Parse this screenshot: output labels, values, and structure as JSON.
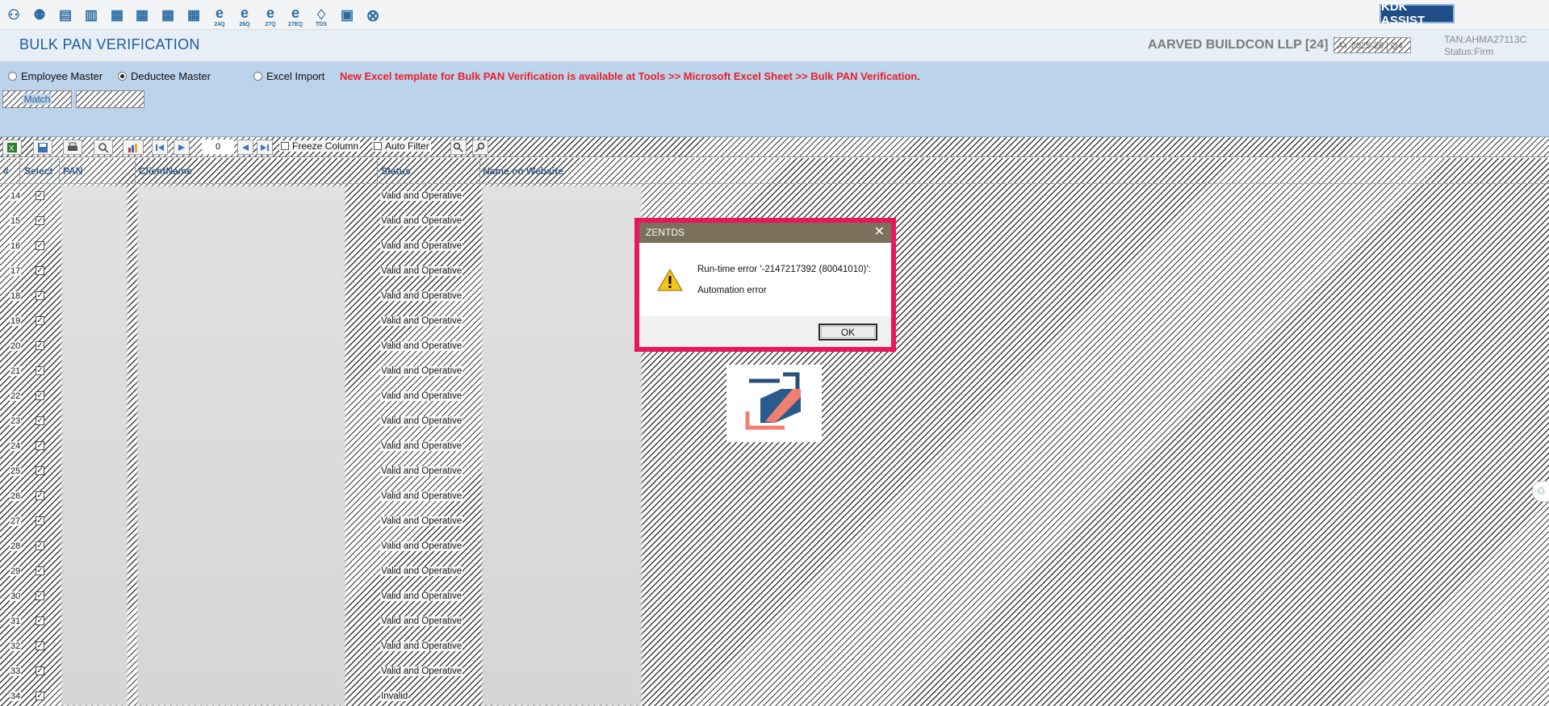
{
  "toolbar": {
    "icons": [
      {
        "name": "people-icon",
        "label": ""
      },
      {
        "name": "group-icon",
        "label": ""
      },
      {
        "name": "form-icon",
        "label": ""
      },
      {
        "name": "form-alt-icon",
        "label": ""
      },
      {
        "name": "form-24q-icon",
        "label": ""
      },
      {
        "name": "form-26q-icon",
        "label": ""
      },
      {
        "name": "form-27q-icon",
        "label": ""
      },
      {
        "name": "form-27eq-icon",
        "label": ""
      },
      {
        "name": "e-24q-icon",
        "label": "24Q"
      },
      {
        "name": "e-26q-icon",
        "label": "26Q"
      },
      {
        "name": "e-27q-icon",
        "label": "27Q"
      },
      {
        "name": "e-27eq-icon",
        "label": "27EQ"
      },
      {
        "name": "tds-icon",
        "label": "TDS"
      },
      {
        "name": "notepad-icon",
        "label": ""
      },
      {
        "name": "close-circle-icon",
        "label": ""
      }
    ],
    "assist_label": "KDK ASSIST"
  },
  "header": {
    "title": "BULK PAN VERIFICATION",
    "company": "AARVED BUILDCON LLP [24]",
    "ay": "AY 2025-26 | Q4",
    "tan": "TAN:AHMA27113C",
    "status": "Status:Firm"
  },
  "options": {
    "employee_master": "Employee Master",
    "deductee_master": "Deductee Master",
    "excel_import": "Excel Import",
    "selected": "deductee_master",
    "notice": "New Excel template for Bulk PAN Verification is available at Tools >> Microsoft Excel Sheet >> Bulk PAN Verification.",
    "match_label": "Match",
    "second_button_label": ""
  },
  "grid_tools": {
    "record_number": "0",
    "freeze_column": "Freeze Column",
    "auto_filter": "Auto Filter"
  },
  "grid": {
    "columns": [
      "#",
      "Select",
      "PAN",
      "ClientName",
      "Status",
      "Name on Website"
    ],
    "rows": [
      {
        "num": "14",
        "status": "Valid and Operative",
        "checked": true
      },
      {
        "num": "15",
        "status": "Valid and Operative",
        "checked": true
      },
      {
        "num": "16",
        "status": "Valid and Operative",
        "checked": true
      },
      {
        "num": "17",
        "status": "Valid and Operative",
        "checked": true
      },
      {
        "num": "18",
        "status": "Valid and Operative",
        "checked": true
      },
      {
        "num": "19",
        "status": "Valid and Operative",
        "checked": true
      },
      {
        "num": "20",
        "status": "Valid and Operative",
        "checked": true
      },
      {
        "num": "21",
        "status": "Valid and Operative",
        "checked": true
      },
      {
        "num": "22",
        "status": "Valid and Operative",
        "checked": true
      },
      {
        "num": "23",
        "status": "Valid and Operative",
        "checked": true
      },
      {
        "num": "24",
        "status": "Valid and Operative",
        "checked": true
      },
      {
        "num": "25",
        "status": "Valid and Operative",
        "checked": true
      },
      {
        "num": "26",
        "status": "Valid and Operative",
        "checked": true
      },
      {
        "num": "27",
        "status": "Valid and Operative",
        "checked": true
      },
      {
        "num": "28",
        "status": "Valid and Operative",
        "checked": true
      },
      {
        "num": "29",
        "status": "Valid and Operative",
        "checked": true
      },
      {
        "num": "30",
        "status": "Valid and Operative",
        "checked": true
      },
      {
        "num": "31",
        "status": "Valid and Operative",
        "checked": true
      },
      {
        "num": "32",
        "status": "Valid and Operative",
        "checked": true
      },
      {
        "num": "33",
        "status": "Valid and Operative",
        "checked": true
      },
      {
        "num": "34",
        "status": "Invalid",
        "checked": true
      }
    ]
  },
  "dialog": {
    "title": "ZENTDS",
    "close": "✕",
    "line1": "Run-time error '-2147217392 (80041010)':",
    "line2": "Automation error",
    "ok_label": "OK"
  },
  "colors": {
    "accent": "#1a5d9c",
    "highlight_border": "#e8175d",
    "notice": "#e8202a",
    "panel": "#bcd3ec"
  }
}
